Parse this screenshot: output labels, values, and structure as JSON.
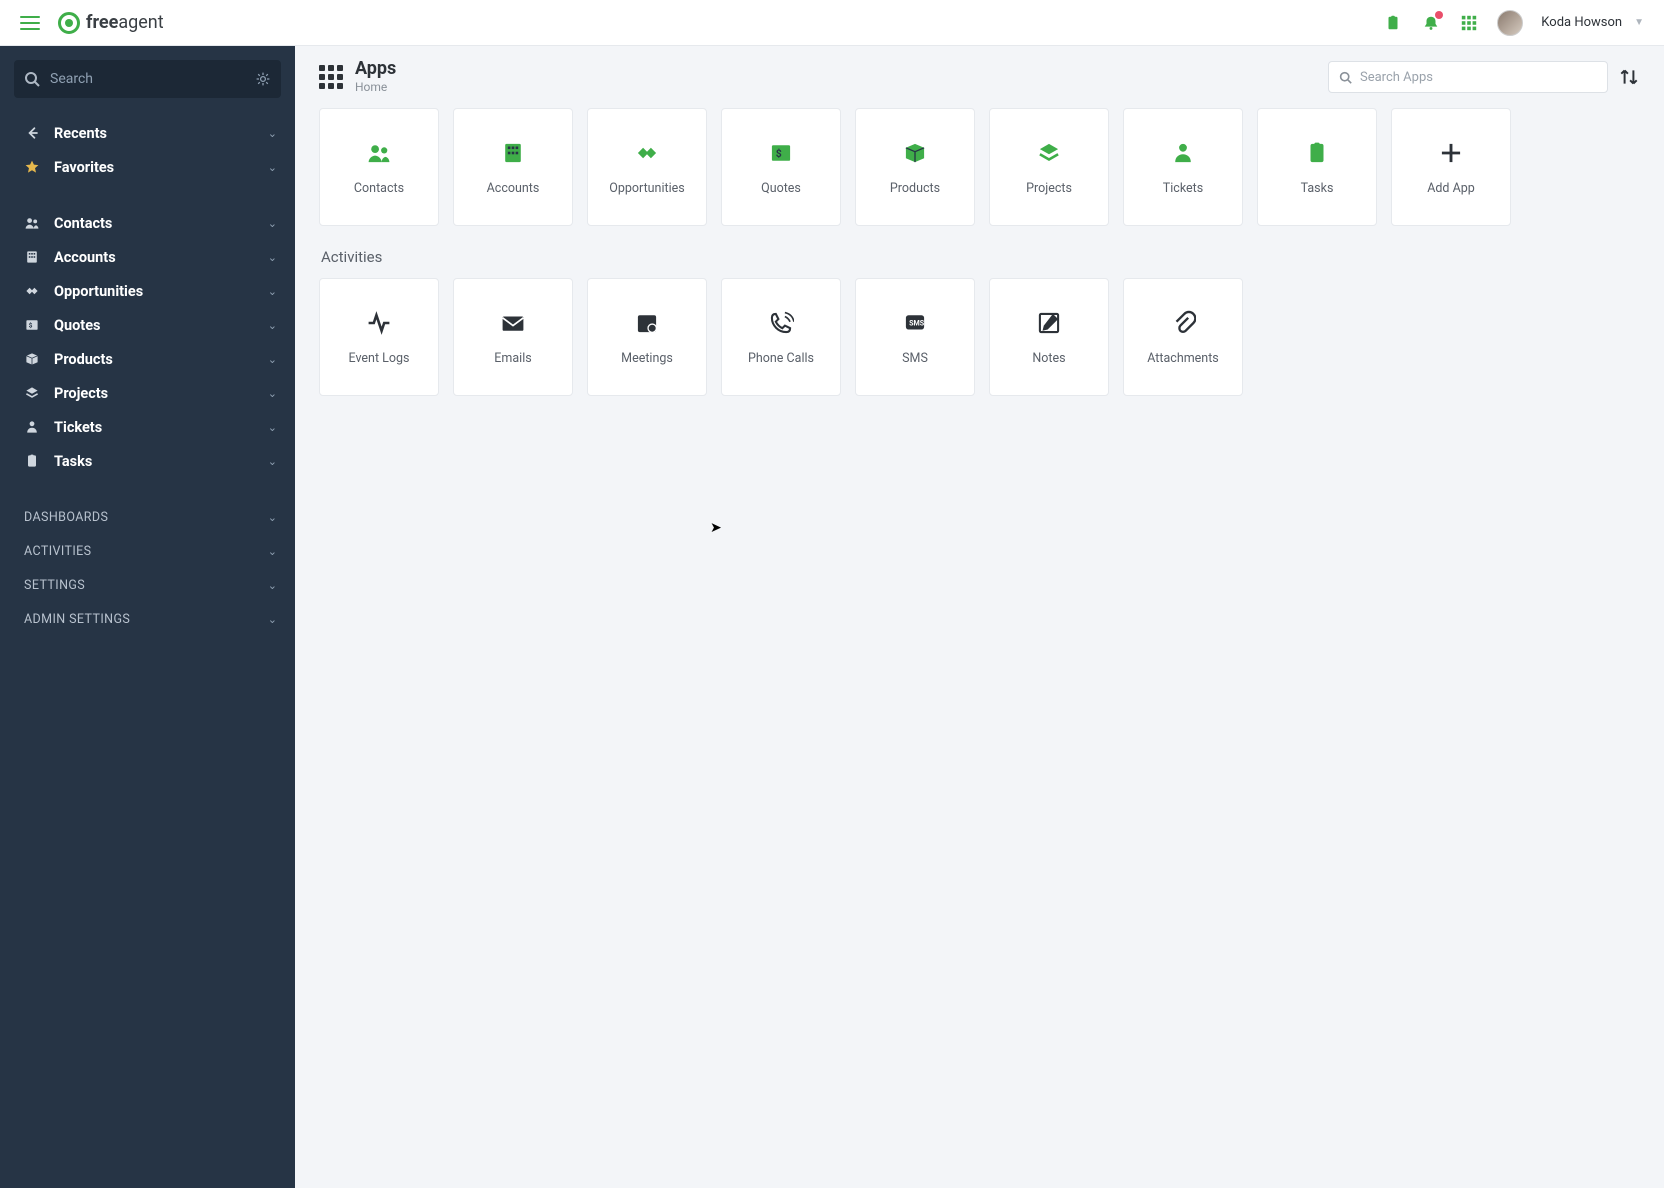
{
  "brand": {
    "bold": "free",
    "rest": "agent"
  },
  "user": {
    "name": "Koda Howson"
  },
  "sidebar": {
    "search_placeholder": "Search",
    "top": [
      {
        "label": "Recents",
        "icon": "arrow-back"
      },
      {
        "label": "Favorites",
        "icon": "star"
      }
    ],
    "main": [
      {
        "label": "Contacts",
        "icon": "people"
      },
      {
        "label": "Accounts",
        "icon": "building"
      },
      {
        "label": "Opportunities",
        "icon": "handshake"
      },
      {
        "label": "Quotes",
        "icon": "quote"
      },
      {
        "label": "Products",
        "icon": "box"
      },
      {
        "label": "Projects",
        "icon": "layers"
      },
      {
        "label": "Tickets",
        "icon": "ticket"
      },
      {
        "label": "Tasks",
        "icon": "clipboard"
      }
    ],
    "sections": [
      {
        "label": "DASHBOARDS"
      },
      {
        "label": "ACTIVITIES"
      },
      {
        "label": "SETTINGS"
      },
      {
        "label": "ADMIN SETTINGS"
      }
    ]
  },
  "header": {
    "title": "Apps",
    "subtitle": "Home",
    "search_placeholder": "Search Apps"
  },
  "apps_primary": [
    {
      "label": "Contacts",
      "icon": "people"
    },
    {
      "label": "Accounts",
      "icon": "building"
    },
    {
      "label": "Opportunities",
      "icon": "handshake"
    },
    {
      "label": "Quotes",
      "icon": "quote"
    },
    {
      "label": "Products",
      "icon": "box"
    },
    {
      "label": "Projects",
      "icon": "layers"
    },
    {
      "label": "Tickets",
      "icon": "ticket"
    },
    {
      "label": "Tasks",
      "icon": "clipboard"
    },
    {
      "label": "Add App",
      "icon": "plus"
    }
  ],
  "activities_title": "Activities",
  "activities": [
    {
      "label": "Event Logs",
      "icon": "activity"
    },
    {
      "label": "Emails",
      "icon": "mail"
    },
    {
      "label": "Meetings",
      "icon": "calendar"
    },
    {
      "label": "Phone Calls",
      "icon": "phone"
    },
    {
      "label": "SMS",
      "icon": "sms"
    },
    {
      "label": "Notes",
      "icon": "note"
    },
    {
      "label": "Attachments",
      "icon": "attach"
    }
  ]
}
